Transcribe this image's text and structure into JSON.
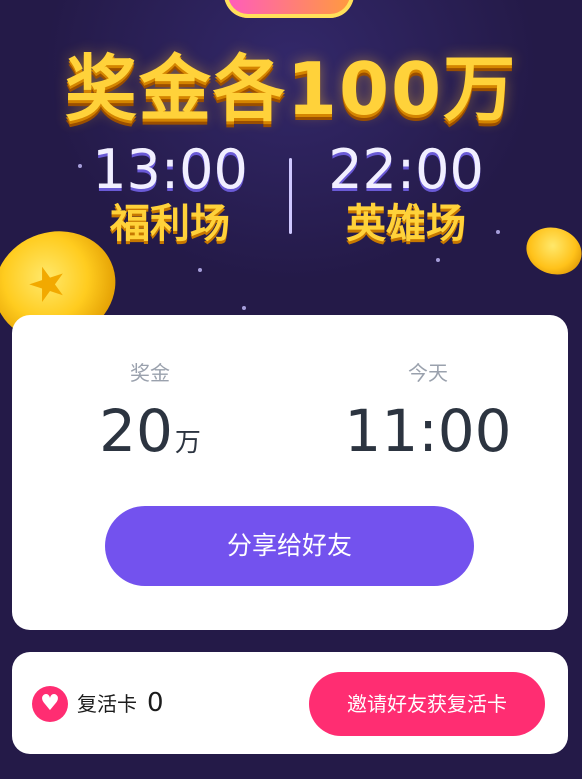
{
  "hero": {
    "headline": "奖金各100万",
    "sessions": [
      {
        "time": "13:00",
        "name": "福利场"
      },
      {
        "time": "22:00",
        "name": "英雄场"
      }
    ]
  },
  "prize_card": {
    "prize_label": "奖金",
    "prize_value": "20",
    "prize_unit": "万",
    "time_label": "今天",
    "time_value": "11:00",
    "share_button": "分享给好友"
  },
  "revive_card": {
    "heart_glyph": "♥",
    "label": "复活卡",
    "count": "0",
    "invite_button": "邀请好友获复活卡"
  },
  "colors": {
    "background": "#241a48",
    "headline_gold": "#ffd23a",
    "share_purple": "#7352ee",
    "invite_pink": "#ff2d72"
  }
}
